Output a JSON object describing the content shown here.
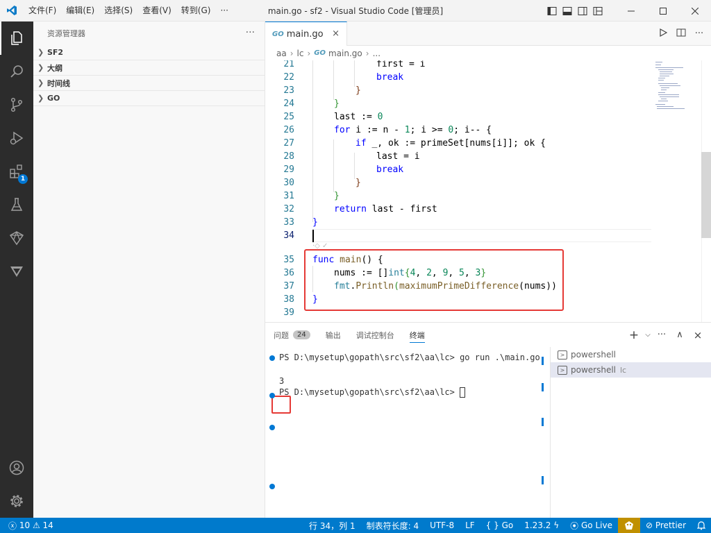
{
  "titlebar": {
    "menu": [
      "文件(F)",
      "编辑(E)",
      "选择(S)",
      "查看(V)",
      "转到(G)",
      "···"
    ],
    "title": "main.go - sf2 - Visual Studio Code [管理员]"
  },
  "activity": {
    "extensions_badge": "1"
  },
  "sidebar": {
    "title": "资源管理器",
    "more": "···",
    "sections": [
      "SF2",
      "大纲",
      "时间线",
      "GO"
    ]
  },
  "tab": {
    "label": "main.go",
    "icon": "GO",
    "close": "×"
  },
  "breadcrumb": {
    "folder1": "aa",
    "folder2": "lc",
    "file": "main.go",
    "rest": "..."
  },
  "editor": {
    "code_lens": "·◇ ✓",
    "lines": [
      {
        "n": "21"
      },
      {
        "n": "22"
      },
      {
        "n": "23"
      },
      {
        "n": "24"
      },
      {
        "n": "25"
      },
      {
        "n": "26"
      },
      {
        "n": "27"
      },
      {
        "n": "28"
      },
      {
        "n": "29"
      },
      {
        "n": "30"
      },
      {
        "n": "31"
      },
      {
        "n": "32"
      },
      {
        "n": "33"
      },
      {
        "n": "34"
      },
      {
        "n": "35"
      },
      {
        "n": "36"
      },
      {
        "n": "37"
      },
      {
        "n": "38"
      },
      {
        "n": "39"
      }
    ],
    "code": {
      "l21a": "first",
      "l21b": " = i",
      "l22": "break",
      "l23": "}",
      "l24": "}",
      "l25a": "last := ",
      "l25b": "0",
      "l26a": "for",
      "l26b": " i := n - ",
      "l26c": "1",
      "l26d": "; i >= ",
      "l26e": "0",
      "l26f": "; i-- {",
      "l27a": "if",
      "l27b": " _, ok := primeSet[nums[i]]; ok {",
      "l28": "last = i",
      "l29": "break",
      "l30": "}",
      "l31": "}",
      "l32a": "return",
      "l32b": " last - first",
      "l33": "}",
      "l35a": "func",
      "l35b": " main",
      "l35c": "() {",
      "l36a": "nums := []",
      "l36b": "int",
      "l36c": "{",
      "l36d": "4",
      "l36e": ", ",
      "l36f": "2",
      "l36g": ", ",
      "l36h": "9",
      "l36i": ", ",
      "l36j": "5",
      "l36k": ", ",
      "l36l": "3",
      "l36m": "}",
      "l37a": "fmt",
      "l37b": ".",
      "l37c": "Println",
      "l37d": "(",
      "l37e": "maximumPrimeDifference",
      "l37f": "(nums))",
      "l38": "}"
    }
  },
  "panel": {
    "tabs": [
      {
        "label": "问题",
        "badge": "24"
      },
      {
        "label": "输出"
      },
      {
        "label": "调试控制台"
      },
      {
        "label": "终端"
      }
    ],
    "actions": {
      "add": "+",
      "split": "⌵",
      "more": "···",
      "maximize": "∧",
      "close": "×"
    },
    "terminal": {
      "cmd_line": "PS D:\\mysetup\\gopath\\src\\sf2\\aa\\lc> go run .\\main.go",
      "output": "3",
      "prompt": "PS D:\\mysetup\\gopath\\src\\sf2\\aa\\lc> "
    },
    "terminal_list": [
      {
        "label": "powershell",
        "sub": ""
      },
      {
        "label": "powershell",
        "sub": "lc"
      }
    ]
  },
  "status": {
    "errors": "10",
    "warnings": "14",
    "position": "行 34，列 1",
    "tab_size": "制表符长度: 4",
    "encoding": "UTF-8",
    "eol": "LF",
    "language": "Go",
    "go_version": "1.23.2",
    "go_live": "Go Live",
    "prettier": "Prettier"
  }
}
